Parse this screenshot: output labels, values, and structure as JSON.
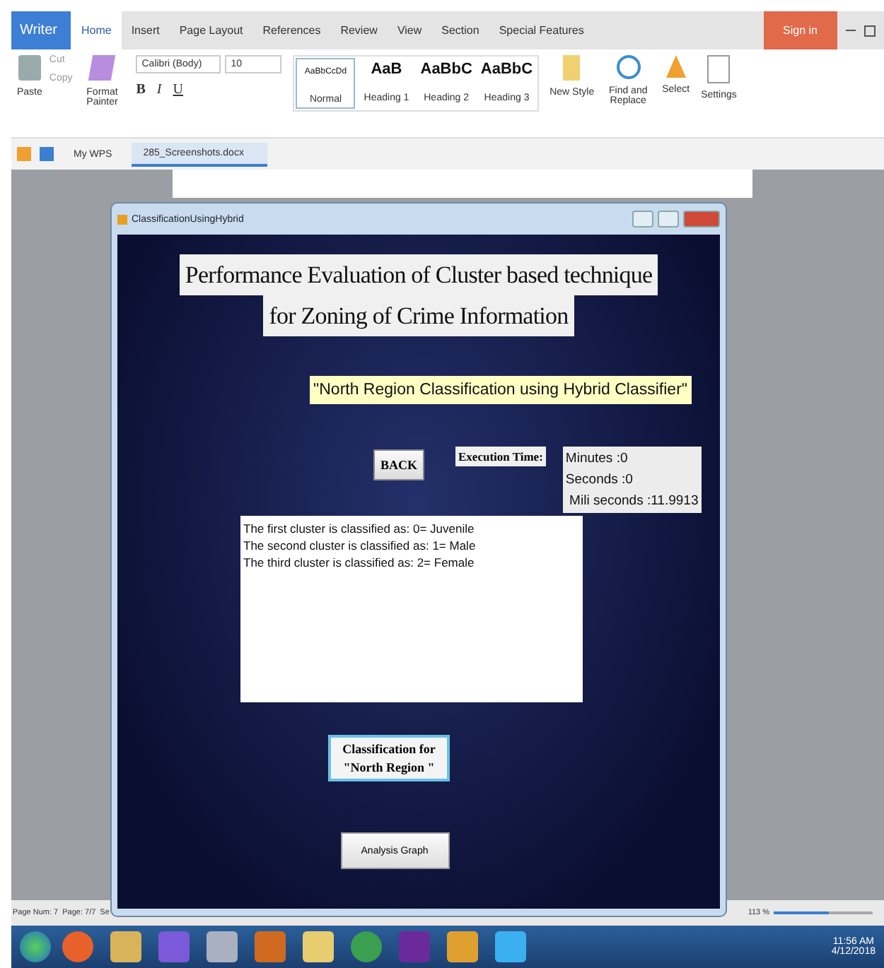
{
  "app": {
    "logo": "Writer",
    "menu_tabs": [
      {
        "label": "Home",
        "selected": true
      },
      {
        "label": "Insert",
        "selected": false
      },
      {
        "label": "Page Layout",
        "selected": false
      },
      {
        "label": "References",
        "selected": false
      },
      {
        "label": "Review",
        "selected": false
      },
      {
        "label": "View",
        "selected": false
      },
      {
        "label": "Section",
        "selected": false
      },
      {
        "label": "Special Features",
        "selected": false
      }
    ],
    "sign_in": "Sign in"
  },
  "ribbon": {
    "paste": "Paste",
    "cut": "Cut",
    "copy": "Copy",
    "format_painter": "Format Painter",
    "font": "Calibri (Body)",
    "size": "10",
    "format_buttons": [
      "B",
      "I",
      "U"
    ],
    "styles": [
      {
        "preview": "AaBbCcDd",
        "name": "Normal",
        "selected": true
      },
      {
        "preview": "AaB",
        "name": "Heading 1",
        "selected": false
      },
      {
        "preview": "AaBbC",
        "name": "Heading 2",
        "selected": false
      },
      {
        "preview": "AaBbC",
        "name": "Heading 3",
        "selected": false
      }
    ],
    "new_style": "New Style",
    "find_replace": "Find and Replace",
    "select": "Select",
    "settings": "Settings"
  },
  "doc_tabs": [
    {
      "label": "My WPS",
      "selected": false
    },
    {
      "label": "285_Screenshots.docx",
      "selected": true
    }
  ],
  "status_bar": {
    "page_num": "Page Num: 7",
    "page": "Page: 7/7",
    "section": "Se",
    "zoom": "113 %",
    "zoom_slider": {
      "level": 0.55
    }
  },
  "taskbar": {
    "time": "11:56 AM",
    "date": "4/12/2018"
  },
  "dialog": {
    "title": "ClassificationUsingHybrid",
    "heading_lines": [
      "Performance Evaluation of Cluster based technique",
      "for Zoning of Crime Information"
    ],
    "subtitle": "\"North Region Classification using Hybrid Classifier\"",
    "back": "BACK",
    "execution_label": "Execution Time:",
    "timings": [
      "Minutes :0",
      "Seconds :0",
      " Mili seconds :11.9913"
    ],
    "results": [
      "The first cluster is classified as: 0= Juvenile",
      "The second cluster is classified as: 1= Male",
      "The third cluster is classified as: 2= Female"
    ],
    "classify_lines": [
      "Classification for",
      "\"North Region \""
    ],
    "analysis": "Analysis Graph"
  }
}
